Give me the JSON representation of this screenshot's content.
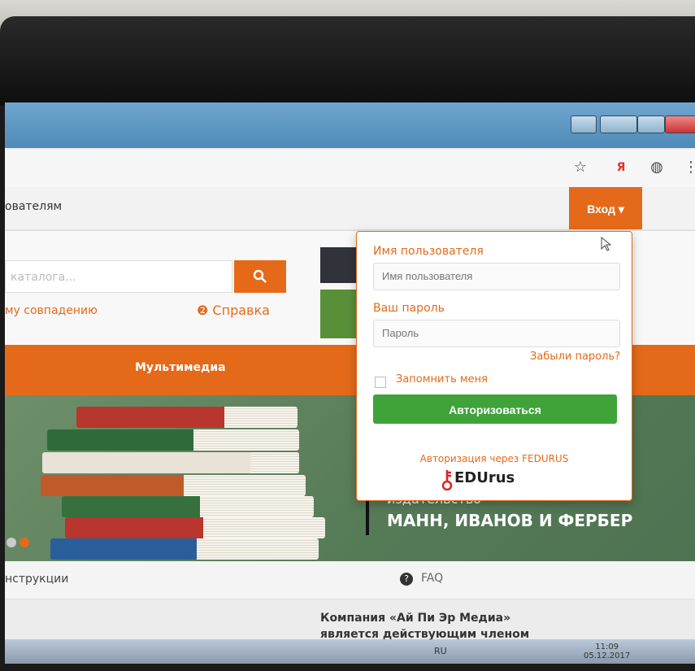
{
  "browser": {
    "star_icon": "☆",
    "yandex_icon": "Я",
    "ext_icon": "◍",
    "menu_icon": "⋮"
  },
  "nav": {
    "link": "ователям",
    "login_button": "Вход ▾"
  },
  "search": {
    "placeholder": "каталога...",
    "search_icon": "🔍",
    "match_link": "му совпадению",
    "help_link": "❷ Справка"
  },
  "menu_bar": {
    "multimedia": "Мультимедиа"
  },
  "banner": {
    "publisher_prefix": "издательство",
    "publisher_name": "МАНН, ИВАНОВ И ФЕРБЕР"
  },
  "info": {
    "instructions": "нструкции",
    "faq": "FAQ"
  },
  "company": {
    "line1": "Компания «Ай Пи Эр Медиа»",
    "line2": "является действующим членом"
  },
  "login": {
    "username_label": "Имя пользователя",
    "username_placeholder": "Имя пользователя",
    "password_label": "Ваш пароль",
    "password_placeholder": "Пароль",
    "forgot": "Забыли пароль?",
    "remember": "Запомнить меня",
    "submit": "Авторизоваться",
    "fedurus_link": "Авторизация через FEDURUS",
    "fedurus_logo": "EDUrus"
  },
  "taskbar": {
    "lang": "RU",
    "time": "11:09",
    "date": "05.12.2017"
  },
  "colors": {
    "accent": "#e46a1a",
    "auth_green": "#3fa33a"
  }
}
